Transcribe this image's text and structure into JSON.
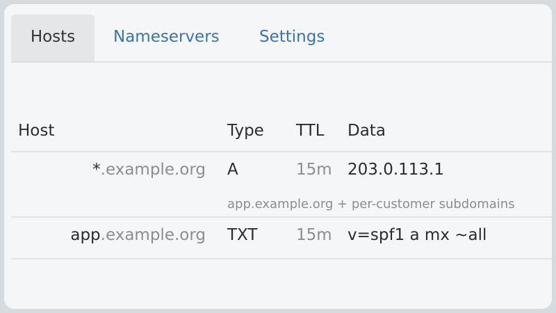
{
  "tabs": [
    {
      "label": "Hosts",
      "active": true
    },
    {
      "label": "Nameservers",
      "active": false
    },
    {
      "label": "Settings",
      "active": false
    }
  ],
  "table": {
    "headers": {
      "host": "Host",
      "type": "Type",
      "ttl": "TTL",
      "data": "Data"
    },
    "rows": [
      {
        "host_prefix": "*",
        "host_domain": ".example.org",
        "type": "A",
        "ttl": "15m",
        "data": "203.0.113.1",
        "note": "app.example.org + per-customer subdomains"
      },
      {
        "host_prefix": "app",
        "host_domain": ".example.org",
        "type": "TXT",
        "ttl": "15m",
        "data": "v=spf1 a mx ~all"
      }
    ]
  },
  "colors": {
    "link": "#3b74ad",
    "text": "#2c2c2c",
    "muted": "#8a8e92",
    "active_tab_bg": "#e4e6e8",
    "frame_bg": "#f5f6f7",
    "outer_bg": "#d6dbe0"
  }
}
